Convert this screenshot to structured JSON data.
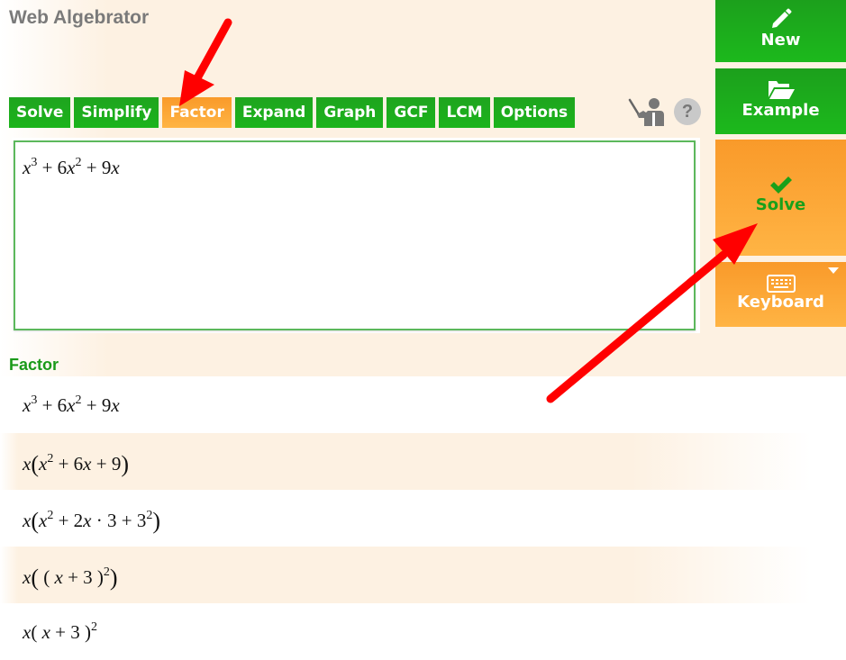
{
  "app": {
    "title": "Web Algebrator"
  },
  "tabs": [
    {
      "label": "Solve",
      "active": false
    },
    {
      "label": "Simplify",
      "active": false
    },
    {
      "label": "Factor",
      "active": true
    },
    {
      "label": "Expand",
      "active": false
    },
    {
      "label": "Graph",
      "active": false
    },
    {
      "label": "GCF",
      "active": false
    },
    {
      "label": "LCM",
      "active": false
    },
    {
      "label": "Options",
      "active": false
    }
  ],
  "toolbar_icons": {
    "teacher": "teacher-icon",
    "help": "?"
  },
  "editor": {
    "expression": "x^3 + 6x^2 + 9x"
  },
  "side_buttons": {
    "new": {
      "label": "New",
      "icon": "pencil-icon"
    },
    "example": {
      "label": "Example",
      "icon": "folder-open-icon"
    },
    "solve": {
      "label": "Solve",
      "icon": "checkmark-icon"
    },
    "keyboard": {
      "label": "Keyboard",
      "icon": "keyboard-icon"
    }
  },
  "result": {
    "title": "Factor",
    "steps": [
      "x^3 + 6x^2 + 9x",
      "x(x^2 + 6x + 9)",
      "x(x^2 + 2x · 3 + 3^2)",
      "x((x + 3)^2)",
      "x(x + 3)^2"
    ]
  },
  "colors": {
    "green": "#1cb01c",
    "orange": "#fca53a",
    "title_gray": "#7a7a7a",
    "section_green": "#1a9a1a",
    "annotation_red": "#ff0000",
    "background_peach": "#fdf1e2"
  }
}
